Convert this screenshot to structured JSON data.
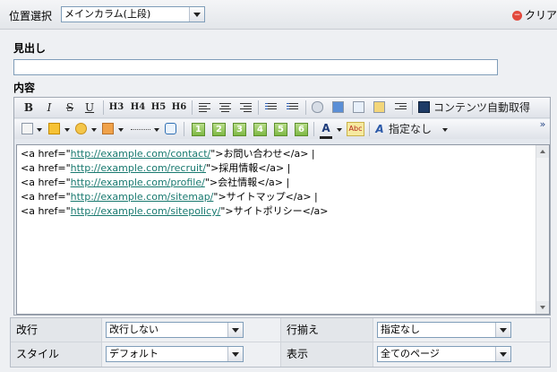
{
  "header": {
    "position_label": "位置選択",
    "position_value": "メインカラム(上段)",
    "clear_label": "クリア"
  },
  "heading": {
    "label": "見出し",
    "value": ""
  },
  "content": {
    "label": "内容",
    "toolbar1": {
      "bold": "B",
      "italic": "I",
      "strike": "S",
      "underline": "U",
      "h3": "H3",
      "h4": "H4",
      "h5": "H5",
      "h6": "H6",
      "fetch_label": "コンテンツ自動取得"
    },
    "toolbar2": {
      "num_buttons": [
        "1",
        "2",
        "3",
        "4",
        "5",
        "6"
      ],
      "font_color_glyph": "A",
      "spell_label": "Abc",
      "style_glyph": "A",
      "style_label": "指定なし",
      "more": "»"
    },
    "lines": [
      {
        "pre": "<a href=\"",
        "url": "http://example.com/contact/",
        "post": "\">お問い合わせ</a> |"
      },
      {
        "pre": "<a href=\"",
        "url": "http://example.com/recruit/",
        "post": "\">採用情報</a> |"
      },
      {
        "pre": "<a href=\"",
        "url": "http://example.com/profile/",
        "post": "\">会社情報</a> |"
      },
      {
        "pre": "<a href=\"",
        "url": "http://example.com/sitemap/",
        "post": "\">サイトマップ</a> |"
      },
      {
        "pre": "<a href=\"",
        "url": "http://example.com/sitepolicy/",
        "post": "\">サイトポリシー</a>"
      }
    ]
  },
  "settings": {
    "linebreak_label": "改行",
    "linebreak_value": "改行しない",
    "align_label": "行揃え",
    "align_value": "指定なし",
    "style_label": "スタイル",
    "style_value": "デフォルト",
    "display_label": "表示",
    "display_value": "全てのページ"
  }
}
